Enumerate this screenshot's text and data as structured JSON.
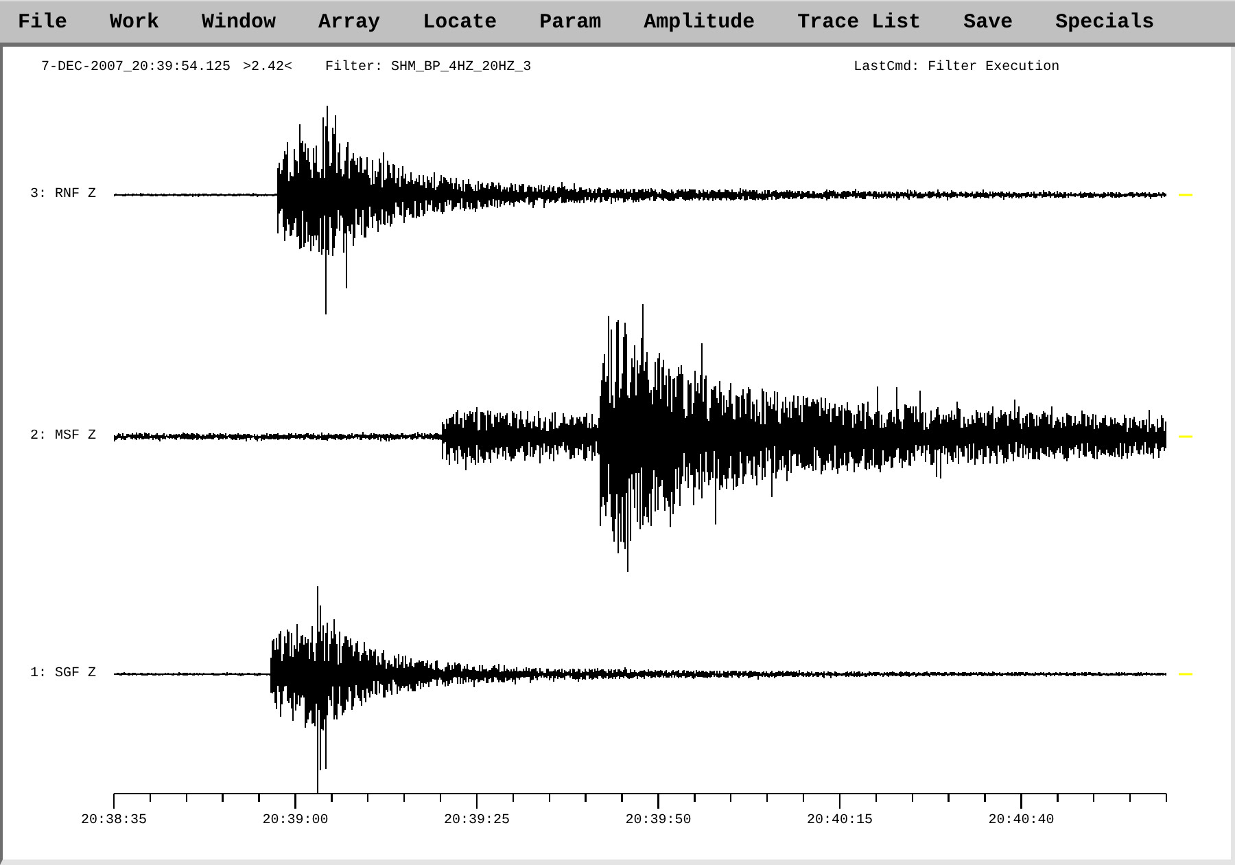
{
  "menu": [
    "File",
    "Work",
    "Window",
    "Array",
    "Locate",
    "Param",
    "Amplitude",
    "Trace List",
    "Save",
    "Specials"
  ],
  "status_line": {
    "timestamp": "7-DEC-2007_20:39:54.125",
    "readout": ">2.42<",
    "filter": "Filter: SHM_BP_4HZ_20HZ_3",
    "last_command": "LastCmd: Filter Execution"
  },
  "traces": [
    {
      "label": "3: RNF Z"
    },
    {
      "label": "2: MSF Z"
    },
    {
      "label": "1: SGF Z"
    }
  ],
  "time_axis": {
    "ticks": [
      "20:38:35",
      "20:39:00",
      "20:39:25",
      "20:39:50",
      "20:40:15",
      "20:40:40"
    ]
  }
}
